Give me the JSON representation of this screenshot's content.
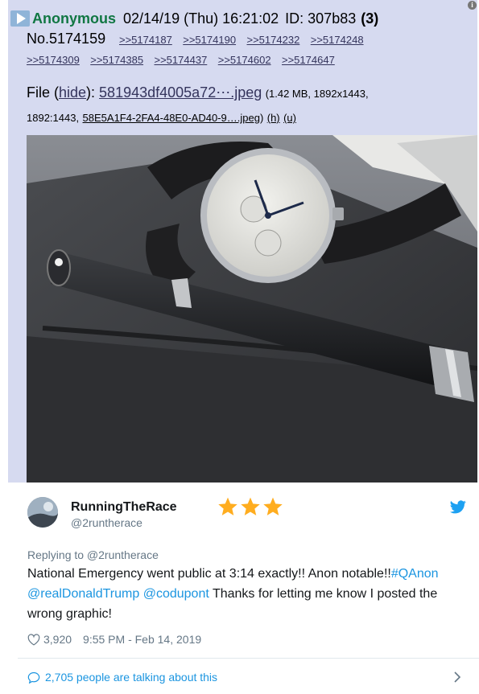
{
  "post": {
    "name": "Anonymous",
    "datetime": "02/14/19 (Thu) 16:21:02",
    "id_label": "ID: 307b83",
    "reply_count": "(3)",
    "post_number": "No.5174159",
    "quote_links": [
      ">>5174187",
      ">>5174190",
      ">>5174232",
      ">>5174248",
      ">>5174309",
      ">>5174385",
      ">>5174437",
      ">>5174602",
      ">>5174647"
    ],
    "file_label": "File",
    "file_hide": "hide",
    "file_name": "581943df4005a72⋯.jpeg",
    "file_meta": "(1.42 MB, 1892x1443,",
    "file_ratio": "1892:1443,",
    "file_original": "58E5A1F4-2FA4-48E0-AD40-9….jpeg",
    "file_h": "(h)",
    "file_u": "(u)",
    "image_subject": "wristwatch and pen on leather portfolio"
  },
  "tweet": {
    "display_name": "RunningTheRace",
    "handle": "@2runtherace",
    "reply_to": "Replying to @2runtherace",
    "text_1": "National Emergency went public at 3:14 exactly!! Anon notable!!",
    "hashtag": "#QAnon",
    "mention_1": "@realDonaldTrump",
    "mention_2": "@codupont",
    "text_2": "Thanks for letting me know I posted the wrong graphic!",
    "likes": "3,920",
    "timestamp": "9:55 PM - Feb 14, 2019",
    "talking": "2,705 people are talking about this",
    "star_count": 3
  },
  "colors": {
    "post_bg": "#d6daf0",
    "poster_name": "#117743",
    "quote_link": "#34345c",
    "twitter_blue": "#1b95e0",
    "star": "#ffad1f"
  },
  "icons": [
    "play-icon",
    "info-icon",
    "twitter-bird-icon",
    "star-icon",
    "heart-icon",
    "speech-bubble-icon",
    "chevron-right-icon"
  ]
}
